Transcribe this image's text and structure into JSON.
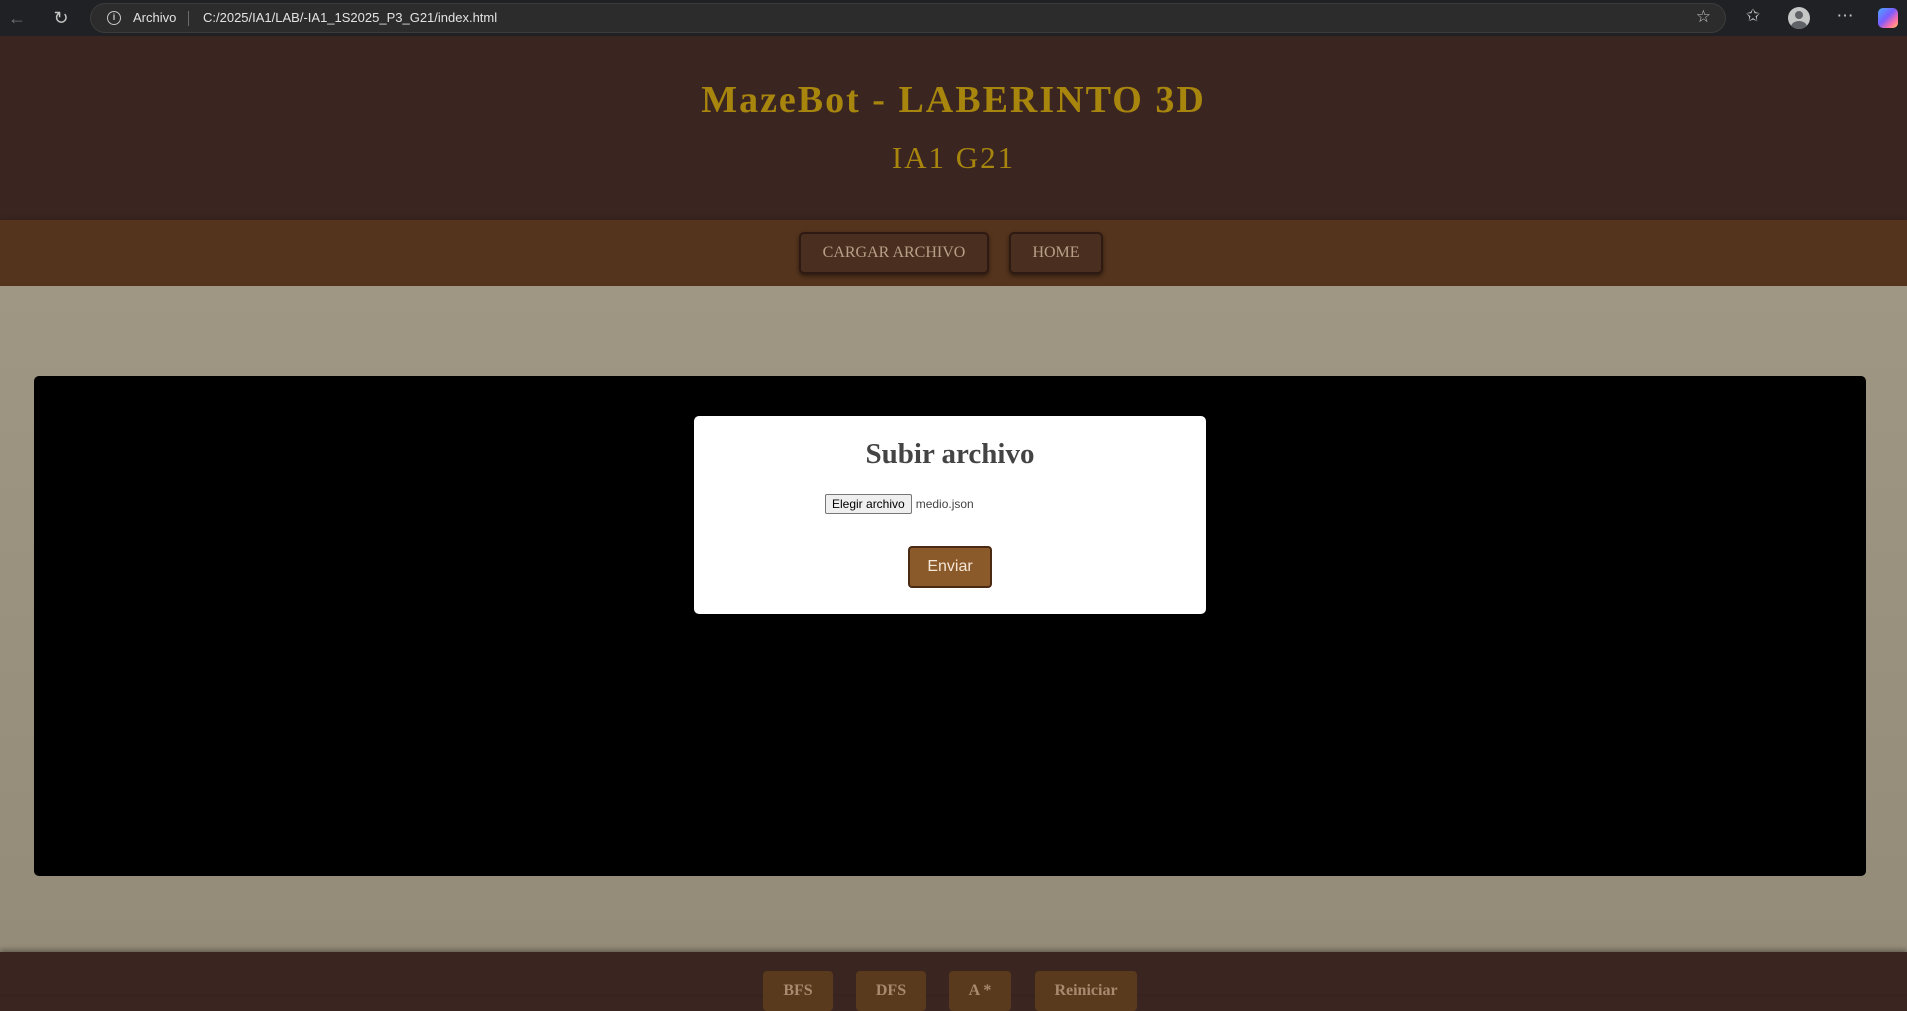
{
  "browser": {
    "back_icon": "arrow-left-icon",
    "reload_icon": "reload-icon",
    "site_info_label": "Archivo",
    "url": "C:/2025/IA1/LAB/-IA1_1S2025_P3_G21/index.html",
    "favorite_icon": "star-icon",
    "favorites_icon": "favorites-icon",
    "profile_icon": "profile-icon",
    "menu_icon": "more-icon",
    "copilot_icon": "copilot-icon"
  },
  "header": {
    "title": "MazeBot - LABERINTO 3D",
    "subtitle": "IA1 G21"
  },
  "nav": {
    "items": [
      {
        "label": "CARGAR ARCHIVO"
      },
      {
        "label": "HOME"
      }
    ]
  },
  "modal": {
    "title": "Subir archivo",
    "file_button": "Elegir archivo",
    "file_name": "medio.json",
    "submit": "Enviar"
  },
  "footer": {
    "buttons": [
      {
        "label": "BFS"
      },
      {
        "label": "DFS"
      },
      {
        "label": "A *"
      },
      {
        "label": "Reiniciar"
      }
    ]
  },
  "colors": {
    "header_bg": "#3a2520",
    "nav_bg": "#55341d",
    "title_gold": "#a8860e",
    "main_bg": "#9f9683",
    "submit_bg": "#8b5a2b"
  }
}
